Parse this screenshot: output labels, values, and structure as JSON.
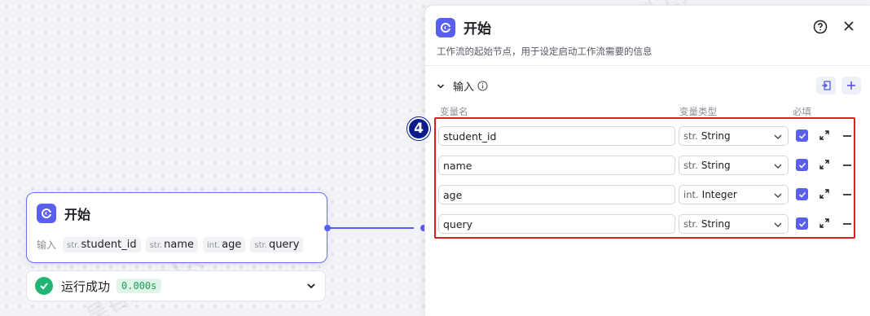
{
  "watermark": "吴百豹-AI大模型工具课",
  "node": {
    "title": "开始",
    "inputs_label": "输入",
    "inputs": [
      {
        "type": "str.",
        "name": "student_id"
      },
      {
        "type": "str.",
        "name": "name"
      },
      {
        "type": "int.",
        "name": "age"
      },
      {
        "type": "str.",
        "name": "query"
      }
    ],
    "accent": "#5b5ff0"
  },
  "run_status": {
    "text": "运行成功",
    "time": "0.000s",
    "color": "#22b573"
  },
  "panel": {
    "title": "开始",
    "description": "工作流的起始节点，用于设定启动工作流需要的信息",
    "section_label": "输入",
    "columns": {
      "name": "变量名",
      "type": "变量类型",
      "required": "必填"
    },
    "annotation_badge": "4",
    "variables": [
      {
        "name": "student_id",
        "type_prefix": "str.",
        "type": "String",
        "required": true
      },
      {
        "name": "name",
        "type_prefix": "str.",
        "type": "String",
        "required": true
      },
      {
        "name": "age",
        "type_prefix": "int.",
        "type": "Integer",
        "required": true
      },
      {
        "name": "query",
        "type_prefix": "str.",
        "type": "String",
        "required": true
      }
    ]
  },
  "icons": [
    "app-logo-icon",
    "help-icon",
    "close-icon",
    "chevron-down-icon",
    "info-icon",
    "import-icon",
    "add-icon",
    "checkbox-icon",
    "expand-icon",
    "remove-icon",
    "success-icon"
  ],
  "highlight_color": "#d81e1e"
}
